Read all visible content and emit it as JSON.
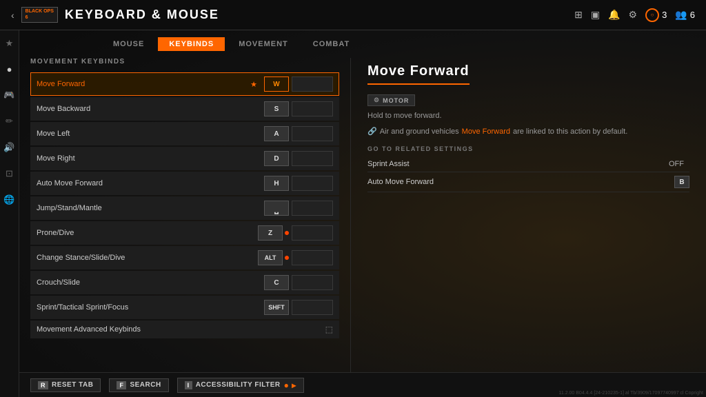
{
  "app": {
    "game_badge_line1": "BLACK OPS",
    "game_badge_line2": "6",
    "page_title": "KEYBOARD & MOUSE",
    "back_label": "‹"
  },
  "topbar": {
    "icons": [
      "⊞",
      "⬛",
      "🔔",
      "⚙"
    ],
    "player_count": "3",
    "group_count": "6"
  },
  "tabs": [
    {
      "id": "mouse",
      "label": "MOUSE",
      "active": false
    },
    {
      "id": "keybinds",
      "label": "KEYBINDS",
      "active": true
    },
    {
      "id": "movement",
      "label": "MOVEMENT",
      "active": false
    },
    {
      "id": "combat",
      "label": "COMBAT",
      "active": false
    }
  ],
  "sidebar_icons": [
    "★",
    "●",
    "🎮",
    "✏",
    "🔊",
    "⊡",
    "🌐"
  ],
  "movement_section": {
    "title": "MOVEMENT KEYBINDS",
    "rows": [
      {
        "name": "Move Forward",
        "key1": "W",
        "key2": "",
        "active": true,
        "starred": true,
        "dot": false
      },
      {
        "name": "Move Backward",
        "key1": "S",
        "key2": "",
        "active": false,
        "starred": false,
        "dot": false
      },
      {
        "name": "Move Left",
        "key1": "A",
        "key2": "",
        "active": false,
        "starred": false,
        "dot": false
      },
      {
        "name": "Move Right",
        "key1": "D",
        "key2": "",
        "active": false,
        "starred": false,
        "dot": false
      },
      {
        "name": "Auto Move Forward",
        "key1": "H",
        "key2": "",
        "active": false,
        "starred": false,
        "dot": false
      },
      {
        "name": "Jump/Stand/Mantle",
        "key1": "␣",
        "key2": "",
        "active": false,
        "starred": false,
        "dot": false
      },
      {
        "name": "Prone/Dive",
        "key1": "Z",
        "key2": "",
        "active": false,
        "starred": false,
        "dot": true
      },
      {
        "name": "Change Stance/Slide/Dive",
        "key1": "ALT",
        "key2": "",
        "active": false,
        "starred": false,
        "dot": true
      },
      {
        "name": "Crouch/Slide",
        "key1": "C",
        "key2": "",
        "active": false,
        "starred": false,
        "dot": false
      },
      {
        "name": "Sprint/Tactical Sprint/Focus",
        "key1": "SHFT",
        "key2": "",
        "active": false,
        "starred": false,
        "dot": false
      },
      {
        "name": "Movement Advanced Keybinds",
        "key1": "",
        "key2": "",
        "active": false,
        "starred": false,
        "dot": false,
        "launch": true
      }
    ]
  },
  "detail": {
    "title": "Move Forward",
    "badge_label": "MOTOR",
    "description": "Hold to move forward.",
    "link_text_before": "Air and ground vehicles",
    "link_text_orange": "Move Forward",
    "link_text_after": "are linked to this action by default.",
    "related_title": "GO TO RELATED SETTINGS",
    "related_rows": [
      {
        "name": "Sprint Assist",
        "value": "OFF",
        "key": ""
      },
      {
        "name": "Auto Move Forward",
        "value": "",
        "key": "B"
      }
    ]
  },
  "bottom_bar": {
    "reset_key": "R",
    "reset_label": "RESET TAB",
    "search_key": "F",
    "search_label": "SEARCH",
    "filter_key": "I",
    "filter_label": "ACCESSIBILITY FILTER",
    "dots": "● ▸"
  },
  "version": "11.2.00 B04.4.4 [24-210235-1] al Tb/3909/17097740997 cl Copright"
}
